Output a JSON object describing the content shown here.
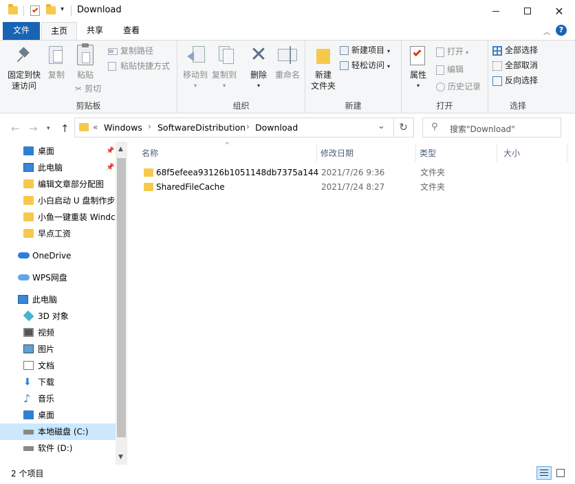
{
  "window": {
    "title": "Download"
  },
  "tabs": {
    "file": "文件",
    "home": "主页",
    "share": "共享",
    "view": "查看"
  },
  "ribbon": {
    "clipboard": {
      "label": "剪贴板",
      "pin": "固定到快\n速访问",
      "pin1": "固定到快",
      "pin2": "速访问",
      "copy": "复制",
      "paste": "粘贴",
      "copy_path": "复制路径",
      "paste_shortcut": "粘贴快捷方式",
      "cut": "剪切"
    },
    "organize": {
      "label": "组织",
      "move_to": "移动到",
      "copy_to": "复制到",
      "delete": "删除",
      "rename": "重命名"
    },
    "new": {
      "label": "新建",
      "new_folder1": "新建",
      "new_folder2": "文件夹",
      "new_item": "新建项目",
      "easy_access": "轻松访问"
    },
    "open": {
      "label": "打开",
      "properties": "属性",
      "open": "打开",
      "edit": "编辑",
      "history": "历史记录"
    },
    "select": {
      "label": "选择",
      "select_all": "全部选择",
      "select_none": "全部取消",
      "invert": "反向选择"
    }
  },
  "address": {
    "prefix": "«",
    "crumbs": [
      "Windows",
      "SoftwareDistribution",
      "Download"
    ],
    "search_placeholder": "搜索\"Download\""
  },
  "sidebar": {
    "items": [
      {
        "label": "桌面",
        "icon": "desktop-icon",
        "pinned": true
      },
      {
        "label": "此电脑",
        "icon": "pc-icon",
        "pinned": true
      },
      {
        "label": "编辑文章部分配图",
        "icon": "folder-icon"
      },
      {
        "label": "小白启动 U 盘制作步",
        "icon": "folder-icon"
      },
      {
        "label": "小鱼一键重装 Windc",
        "icon": "folder-icon"
      },
      {
        "label": "早点工资",
        "icon": "folder-icon"
      }
    ],
    "onedrive": "OneDrive",
    "wps": "WPS网盘",
    "thispc": "此电脑",
    "pc_items": [
      {
        "label": "3D 对象",
        "icon": "3d-objects-icon"
      },
      {
        "label": "视频",
        "icon": "video-icon"
      },
      {
        "label": "图片",
        "icon": "pictures-icon"
      },
      {
        "label": "文档",
        "icon": "documents-icon"
      },
      {
        "label": "下载",
        "icon": "download-icon"
      },
      {
        "label": "音乐",
        "icon": "music-icon"
      },
      {
        "label": "桌面",
        "icon": "desktop-icon"
      },
      {
        "label": "本地磁盘 (C:)",
        "icon": "drive-icon",
        "selected": true
      },
      {
        "label": "软件 (D:)",
        "icon": "drive-icon"
      }
    ]
  },
  "columns": {
    "name": "名称",
    "modified": "修改日期",
    "type": "类型",
    "size": "大小"
  },
  "files": [
    {
      "name": "68f5efeea93126b1051148db7375a144",
      "modified": "2021/7/26 9:36",
      "type": "文件夹",
      "size": ""
    },
    {
      "name": "SharedFileCache",
      "modified": "2021/7/24 8:27",
      "type": "文件夹",
      "size": ""
    }
  ],
  "status": {
    "count": "2 个项目"
  },
  "colors": {
    "accent": "#1a63b4",
    "folder": "#f6c94d",
    "selected": "#cce8ff"
  }
}
